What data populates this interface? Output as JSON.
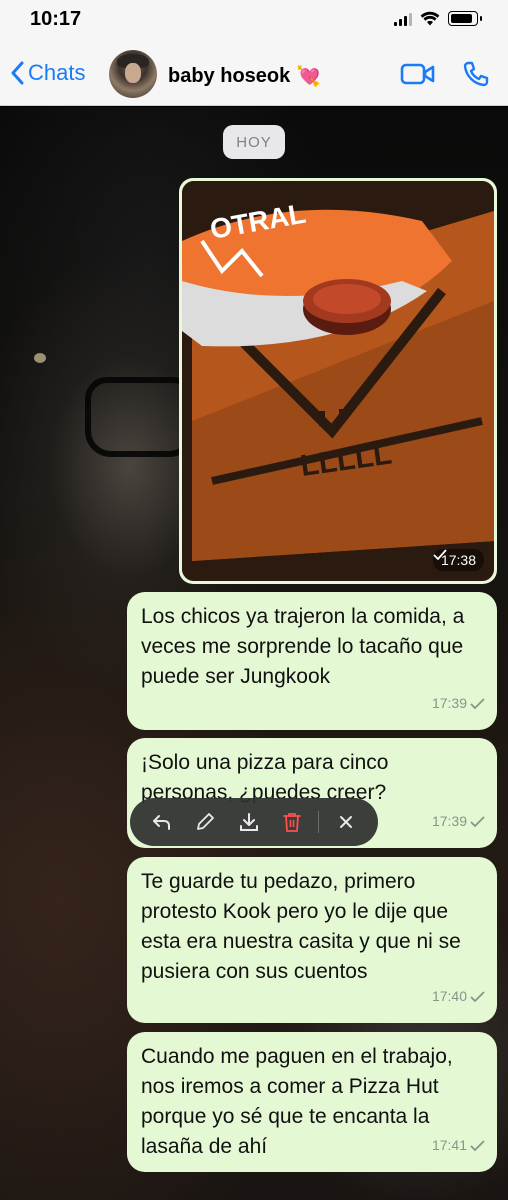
{
  "status_bar": {
    "time": "10:17"
  },
  "header": {
    "back_label": "Chats",
    "contact_name": "baby hoseok",
    "contact_emoji": "💘",
    "icons": [
      "chevron-left-icon",
      "avatar",
      "video-call-icon",
      "phone-icon"
    ]
  },
  "chat": {
    "date_chip": "HOY",
    "image_message": {
      "time": "17:38",
      "status": "sent"
    },
    "messages": [
      {
        "text": "Los chicos ya trajeron la comida, a veces me sorprende lo tacaño que puede ser Jungkook",
        "time": "17:39",
        "status": "sent"
      },
      {
        "text": "¡Solo una pizza para cinco personas, ¿puedes creer?",
        "time": "17:39",
        "status": "sent"
      },
      {
        "text": "Te guarde tu pedazo, primero protesto Kook pero yo le dije que esta era nuestra casita y que ni se pusiera con sus cuentos",
        "time": "17:40",
        "status": "sent"
      },
      {
        "text": "Cuando me paguen en el trabajo, nos iremos a comer a Pizza Hut porque yo sé que te encanta la lasaña de ahí",
        "time": "17:41",
        "status": "sent"
      }
    ]
  },
  "action_bar": {
    "actions": [
      "reply-icon",
      "edit-icon",
      "download-icon",
      "delete-icon",
      "close-icon"
    ]
  },
  "colors": {
    "accent": "#1a7cf5",
    "bubble": "#e5f8d4",
    "delete": "#ff4f4f"
  }
}
